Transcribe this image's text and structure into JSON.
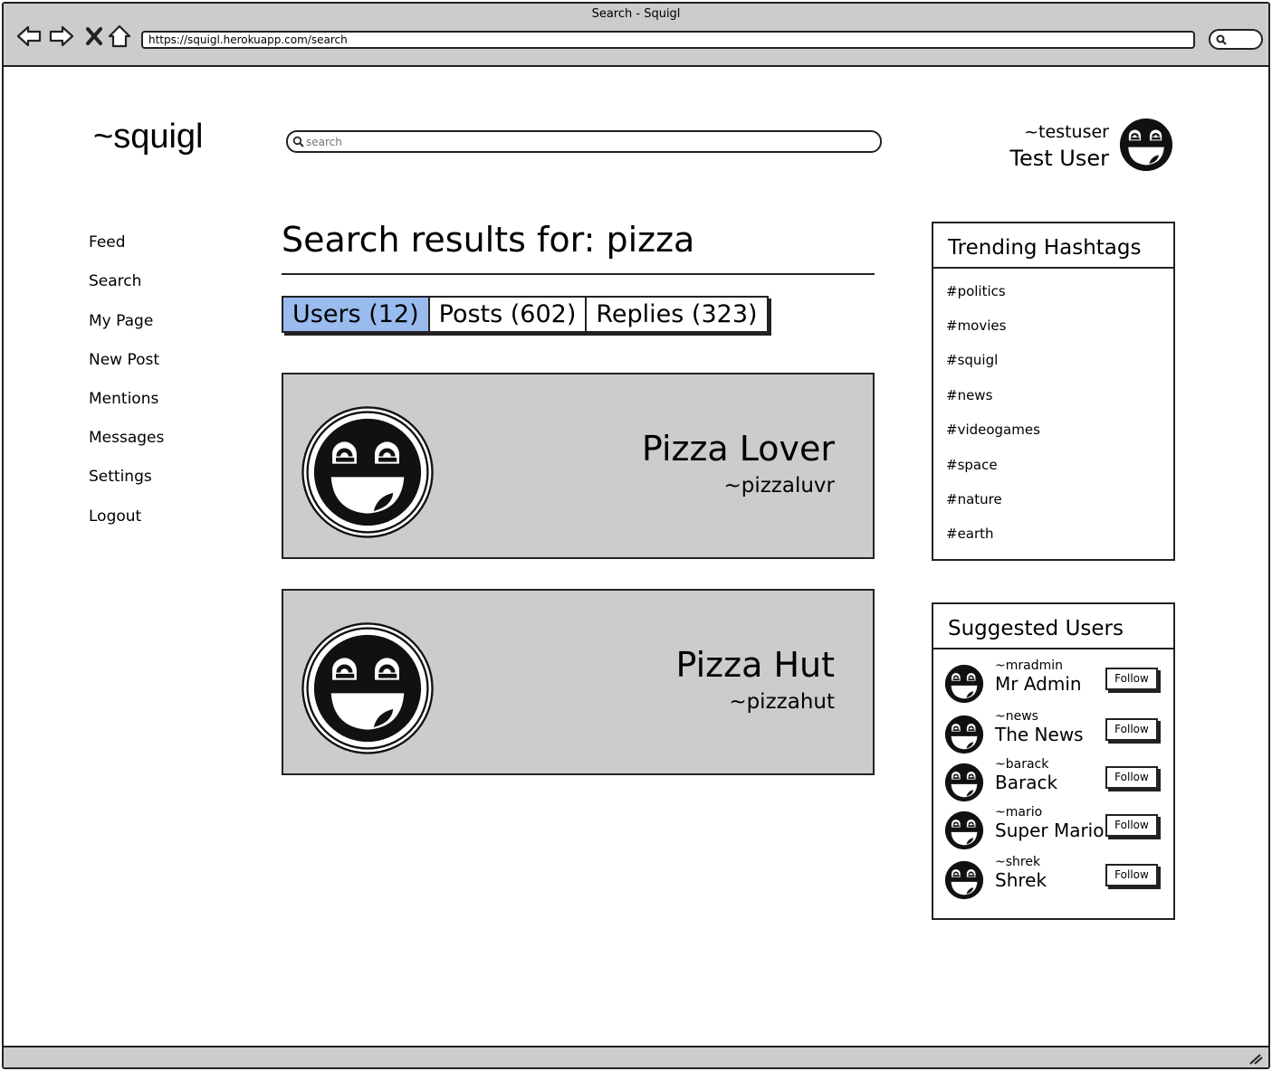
{
  "browser": {
    "window_title": "Search - Squigl",
    "url": "https://squigl.herokuapp.com/search"
  },
  "header": {
    "logo": "~squigl",
    "search_placeholder": "search",
    "current_user": {
      "handle": "~testuser",
      "name": "Test User"
    }
  },
  "nav": [
    "Feed",
    "Search",
    "My Page",
    "New Post",
    "Mentions",
    "Messages",
    "Settings",
    "Logout"
  ],
  "main": {
    "title": "Search results for: pizza",
    "tabs": [
      {
        "label": "Users (12)",
        "active": true
      },
      {
        "label": "Posts (602)",
        "active": false
      },
      {
        "label": "Replies (323)",
        "active": false
      }
    ],
    "results": [
      {
        "name": "Pizza Lover",
        "handle": "~pizzaluvr"
      },
      {
        "name": "Pizza Hut",
        "handle": "~pizzahut"
      }
    ]
  },
  "trending": {
    "title": "Trending Hashtags",
    "tags": [
      "#politics",
      "#movies",
      "#squigl",
      "#news",
      "#videogames",
      "#space",
      "#nature",
      "#earth"
    ]
  },
  "suggested": {
    "title": "Suggested Users",
    "follow_label": "Follow",
    "users": [
      {
        "handle": "~mradmin",
        "name": "Mr Admin"
      },
      {
        "handle": "~news",
        "name": "The News"
      },
      {
        "handle": "~barack",
        "name": "Barack"
      },
      {
        "handle": "~mario",
        "name": "Super Mario"
      },
      {
        "handle": "~shrek",
        "name": "Shrek"
      }
    ]
  },
  "colors": {
    "tab_active": "#99bbee",
    "card_bg": "#cccccc",
    "chrome_bg": "#cccccc"
  }
}
